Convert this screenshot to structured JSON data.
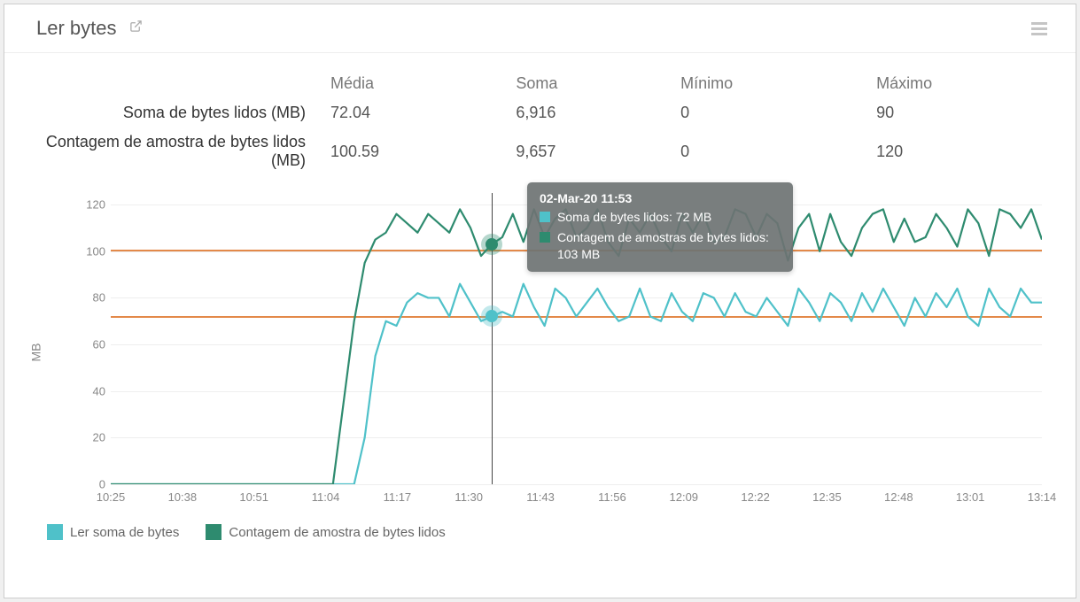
{
  "header": {
    "title": "Ler bytes"
  },
  "stats": {
    "columns": [
      "Média",
      "Soma",
      "Mínimo",
      "Máximo"
    ],
    "rows": [
      {
        "label": "Soma de bytes lidos (MB)",
        "values": [
          "72.04",
          "6,916",
          "0",
          "90"
        ]
      },
      {
        "label": "Contagem de amostra de bytes lidos (MB)",
        "values": [
          "100.59",
          "9,657",
          "0",
          "120"
        ]
      }
    ]
  },
  "legend": {
    "items": [
      {
        "label": "Ler soma de bytes",
        "class": "s0"
      },
      {
        "label": "Contagem de amostra de bytes lidos",
        "class": "s1"
      }
    ]
  },
  "tooltip": {
    "timestamp": "02-Mar-20 11:53",
    "rows": [
      {
        "class": "s0",
        "text": "Soma de bytes lidos: 72 MB"
      },
      {
        "class": "s1",
        "text": "Contagem de amostras de bytes lidos: 103 MB"
      }
    ]
  },
  "chart_data": {
    "type": "line",
    "ylabel": "MB",
    "xlabel": "",
    "ylim": [
      0,
      125
    ],
    "yticks": [
      0,
      20,
      40,
      60,
      80,
      100,
      120
    ],
    "x_tick_labels": [
      "10:25",
      "10:38",
      "10:51",
      "11:04",
      "11:17",
      "11:30",
      "11:43",
      "11:56",
      "12:09",
      "12:22",
      "12:35",
      "12:48",
      "13:01",
      "13:14"
    ],
    "mean_lines": [
      72.04,
      100.59
    ],
    "crosshair_x_index": 36,
    "series": [
      {
        "name": "Ler soma de bytes",
        "color": "#4fc1c9",
        "values": [
          0,
          0,
          0,
          0,
          0,
          0,
          0,
          0,
          0,
          0,
          0,
          0,
          0,
          0,
          0,
          0,
          0,
          0,
          0,
          0,
          0,
          0,
          0,
          0,
          20,
          55,
          70,
          68,
          78,
          82,
          80,
          80,
          72,
          86,
          78,
          70,
          72,
          74,
          72,
          86,
          76,
          68,
          84,
          80,
          72,
          78,
          84,
          76,
          70,
          72,
          84,
          72,
          70,
          82,
          74,
          70,
          82,
          80,
          72,
          82,
          74,
          72,
          80,
          74,
          68,
          84,
          78,
          70,
          82,
          78,
          70,
          82,
          74,
          84,
          76,
          68,
          80,
          72,
          82,
          76,
          84,
          72,
          68,
          84,
          76,
          72,
          84,
          78,
          78
        ]
      },
      {
        "name": "Contagem de amostra de bytes lidos",
        "color": "#2e8b6f",
        "values": [
          0,
          0,
          0,
          0,
          0,
          0,
          0,
          0,
          0,
          0,
          0,
          0,
          0,
          0,
          0,
          0,
          0,
          0,
          0,
          0,
          0,
          0,
          35,
          70,
          95,
          105,
          108,
          116,
          112,
          108,
          116,
          112,
          108,
          118,
          110,
          98,
          103,
          106,
          116,
          104,
          118,
          106,
          114,
          118,
          106,
          110,
          118,
          104,
          98,
          114,
          108,
          116,
          106,
          100,
          116,
          108,
          116,
          104,
          106,
          118,
          116,
          106,
          116,
          112,
          96,
          110,
          116,
          100,
          116,
          104,
          98,
          110,
          116,
          118,
          104,
          114,
          104,
          106,
          116,
          110,
          102,
          118,
          112,
          98,
          118,
          116,
          110,
          118,
          105
        ]
      }
    ]
  }
}
